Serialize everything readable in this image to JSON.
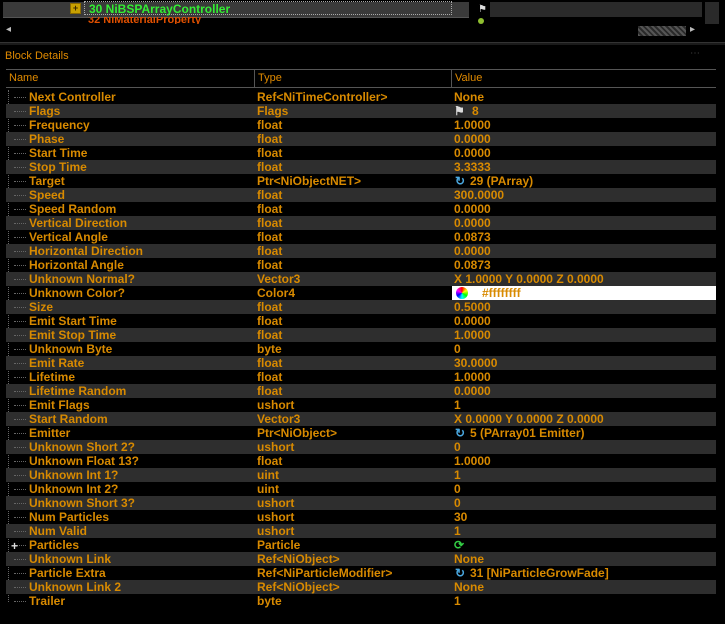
{
  "tree": {
    "selected_item": "30 NiBSPArrayController",
    "next_item": "32 NiMaterialProperty"
  },
  "panel": {
    "title": "Block Details"
  },
  "columns": {
    "name": "Name",
    "type": "Type",
    "value": "Value"
  },
  "rows": [
    {
      "name": "Next Controller",
      "type": "Ref<NiTimeController>",
      "value": "None",
      "icon": ""
    },
    {
      "name": "Flags",
      "type": "Flags",
      "value": "8",
      "icon": "flag-icon"
    },
    {
      "name": "Frequency",
      "type": "float",
      "value": "1.0000",
      "icon": ""
    },
    {
      "name": "Phase",
      "type": "float",
      "value": "0.0000",
      "icon": ""
    },
    {
      "name": "Start Time",
      "type": "float",
      "value": "0.0000",
      "icon": ""
    },
    {
      "name": "Stop Time",
      "type": "float",
      "value": "3.3333",
      "icon": ""
    },
    {
      "name": "Target",
      "type": "Ptr<NiObjectNET>",
      "value": "29 (PArray)",
      "icon": "link-icon"
    },
    {
      "name": "Speed",
      "type": "float",
      "value": "300.0000",
      "icon": ""
    },
    {
      "name": "Speed Random",
      "type": "float",
      "value": "0.0000",
      "icon": ""
    },
    {
      "name": "Vertical Direction",
      "type": "float",
      "value": "0.0000",
      "icon": ""
    },
    {
      "name": "Vertical Angle",
      "type": "float",
      "value": "0.0873",
      "icon": ""
    },
    {
      "name": "Horizontal Direction",
      "type": "float",
      "value": "0.0000",
      "icon": ""
    },
    {
      "name": "Horizontal Angle",
      "type": "float",
      "value": "0.0873",
      "icon": ""
    },
    {
      "name": "Unknown Normal?",
      "type": "Vector3",
      "value": "X 1.0000 Y 0.0000 Z 0.0000",
      "icon": ""
    },
    {
      "name": "Unknown Color?",
      "type": "Color4",
      "value": "#ffffffff",
      "icon": "color-icon"
    },
    {
      "name": "Size",
      "type": "float",
      "value": "0.5000",
      "icon": ""
    },
    {
      "name": "Emit Start Time",
      "type": "float",
      "value": "0.0000",
      "icon": ""
    },
    {
      "name": "Emit Stop Time",
      "type": "float",
      "value": "1.0000",
      "icon": ""
    },
    {
      "name": "Unknown Byte",
      "type": "byte",
      "value": "0",
      "icon": ""
    },
    {
      "name": "Emit Rate",
      "type": "float",
      "value": "30.0000",
      "icon": ""
    },
    {
      "name": "Lifetime",
      "type": "float",
      "value": "1.0000",
      "icon": ""
    },
    {
      "name": "Lifetime Random",
      "type": "float",
      "value": "0.0000",
      "icon": ""
    },
    {
      "name": "Emit Flags",
      "type": "ushort",
      "value": "1",
      "icon": ""
    },
    {
      "name": "Start Random",
      "type": "Vector3",
      "value": "X 0.0000 Y 0.0000 Z 0.0000",
      "icon": ""
    },
    {
      "name": "Emitter",
      "type": "Ptr<NiObject>",
      "value": "5 (PArray01 Emitter)",
      "icon": "link-icon"
    },
    {
      "name": "Unknown Short 2?",
      "type": "ushort",
      "value": "0",
      "icon": ""
    },
    {
      "name": "Unknown Float 13?",
      "type": "float",
      "value": "1.0000",
      "icon": ""
    },
    {
      "name": "Unknown Int 1?",
      "type": "uint",
      "value": "1",
      "icon": ""
    },
    {
      "name": "Unknown Int 2?",
      "type": "uint",
      "value": "0",
      "icon": ""
    },
    {
      "name": "Unknown Short 3?",
      "type": "ushort",
      "value": "0",
      "icon": ""
    },
    {
      "name": "Num Particles",
      "type": "ushort",
      "value": "30",
      "icon": ""
    },
    {
      "name": "Num Valid",
      "type": "ushort",
      "value": "1",
      "icon": ""
    },
    {
      "name": "Particles",
      "type": "Particle",
      "value": "",
      "icon": "refresh-icon",
      "expandable": true
    },
    {
      "name": "Unknown Link",
      "type": "Ref<NiObject>",
      "value": "None",
      "icon": ""
    },
    {
      "name": "Particle Extra",
      "type": "Ref<NiParticleModifier>",
      "value": "31 [NiParticleGrowFade]",
      "icon": "link-icon"
    },
    {
      "name": "Unknown Link 2",
      "type": "Ref<NiObject>",
      "value": "None",
      "icon": ""
    },
    {
      "name": "Trailer",
      "type": "byte",
      "value": "1",
      "icon": ""
    }
  ]
}
